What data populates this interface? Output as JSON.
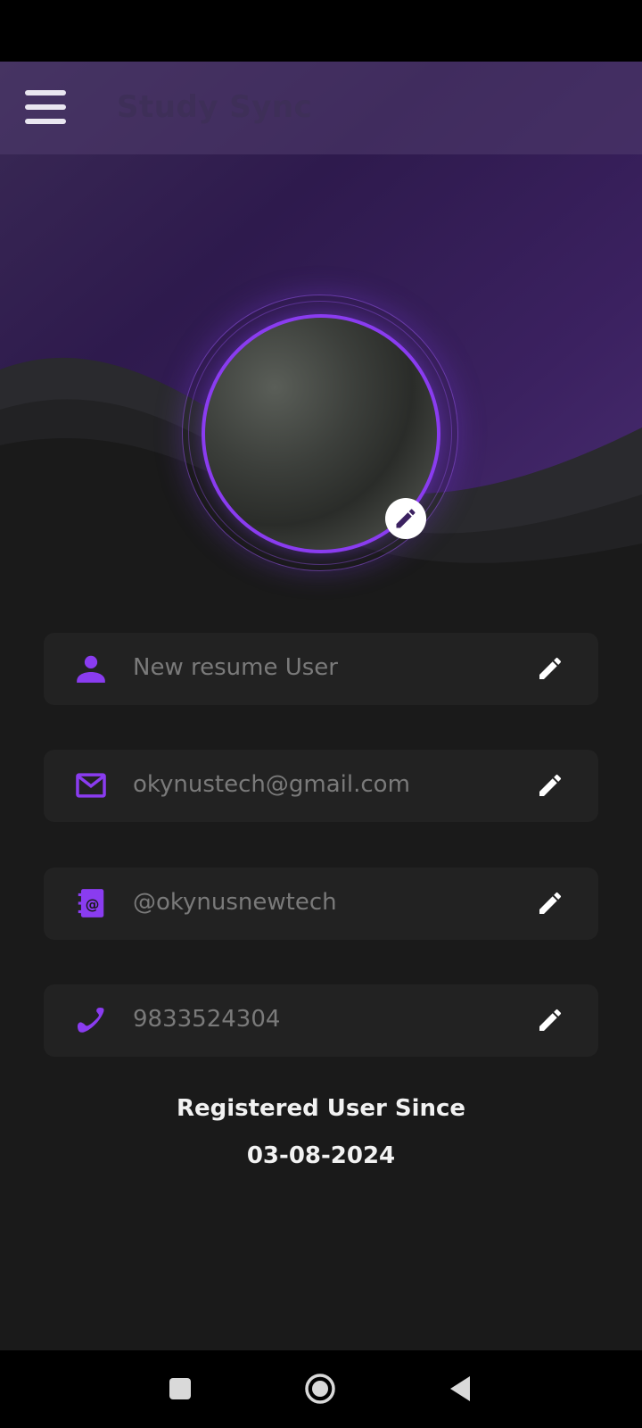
{
  "app_bar": {
    "title": "Study Sync",
    "menu_icon": "hamburger-menu-icon"
  },
  "profile": {
    "avatar_edit_icon": "pencil-icon"
  },
  "fields": [
    {
      "icon": "person-icon",
      "value": "New resume User",
      "edit_icon": "pencil-icon"
    },
    {
      "icon": "mail-icon",
      "value": "okynustech@gmail.com",
      "edit_icon": "pencil-icon"
    },
    {
      "icon": "contact-book-icon",
      "value": "@okynusnewtech",
      "edit_icon": "pencil-icon"
    },
    {
      "icon": "phone-icon",
      "value": "9833524304",
      "edit_icon": "pencil-icon"
    }
  ],
  "registration": {
    "label": "Registered User Since",
    "date": "03-08-2024"
  },
  "colors": {
    "accent": "#8a3cf0",
    "background": "#1a1a1a",
    "field_bg": "#222222",
    "field_text": "#7a7a7a",
    "hero_purple": "#3b2160"
  },
  "system_nav": {
    "buttons": [
      "recents-square-icon",
      "home-circle-icon",
      "back-triangle-icon"
    ]
  }
}
